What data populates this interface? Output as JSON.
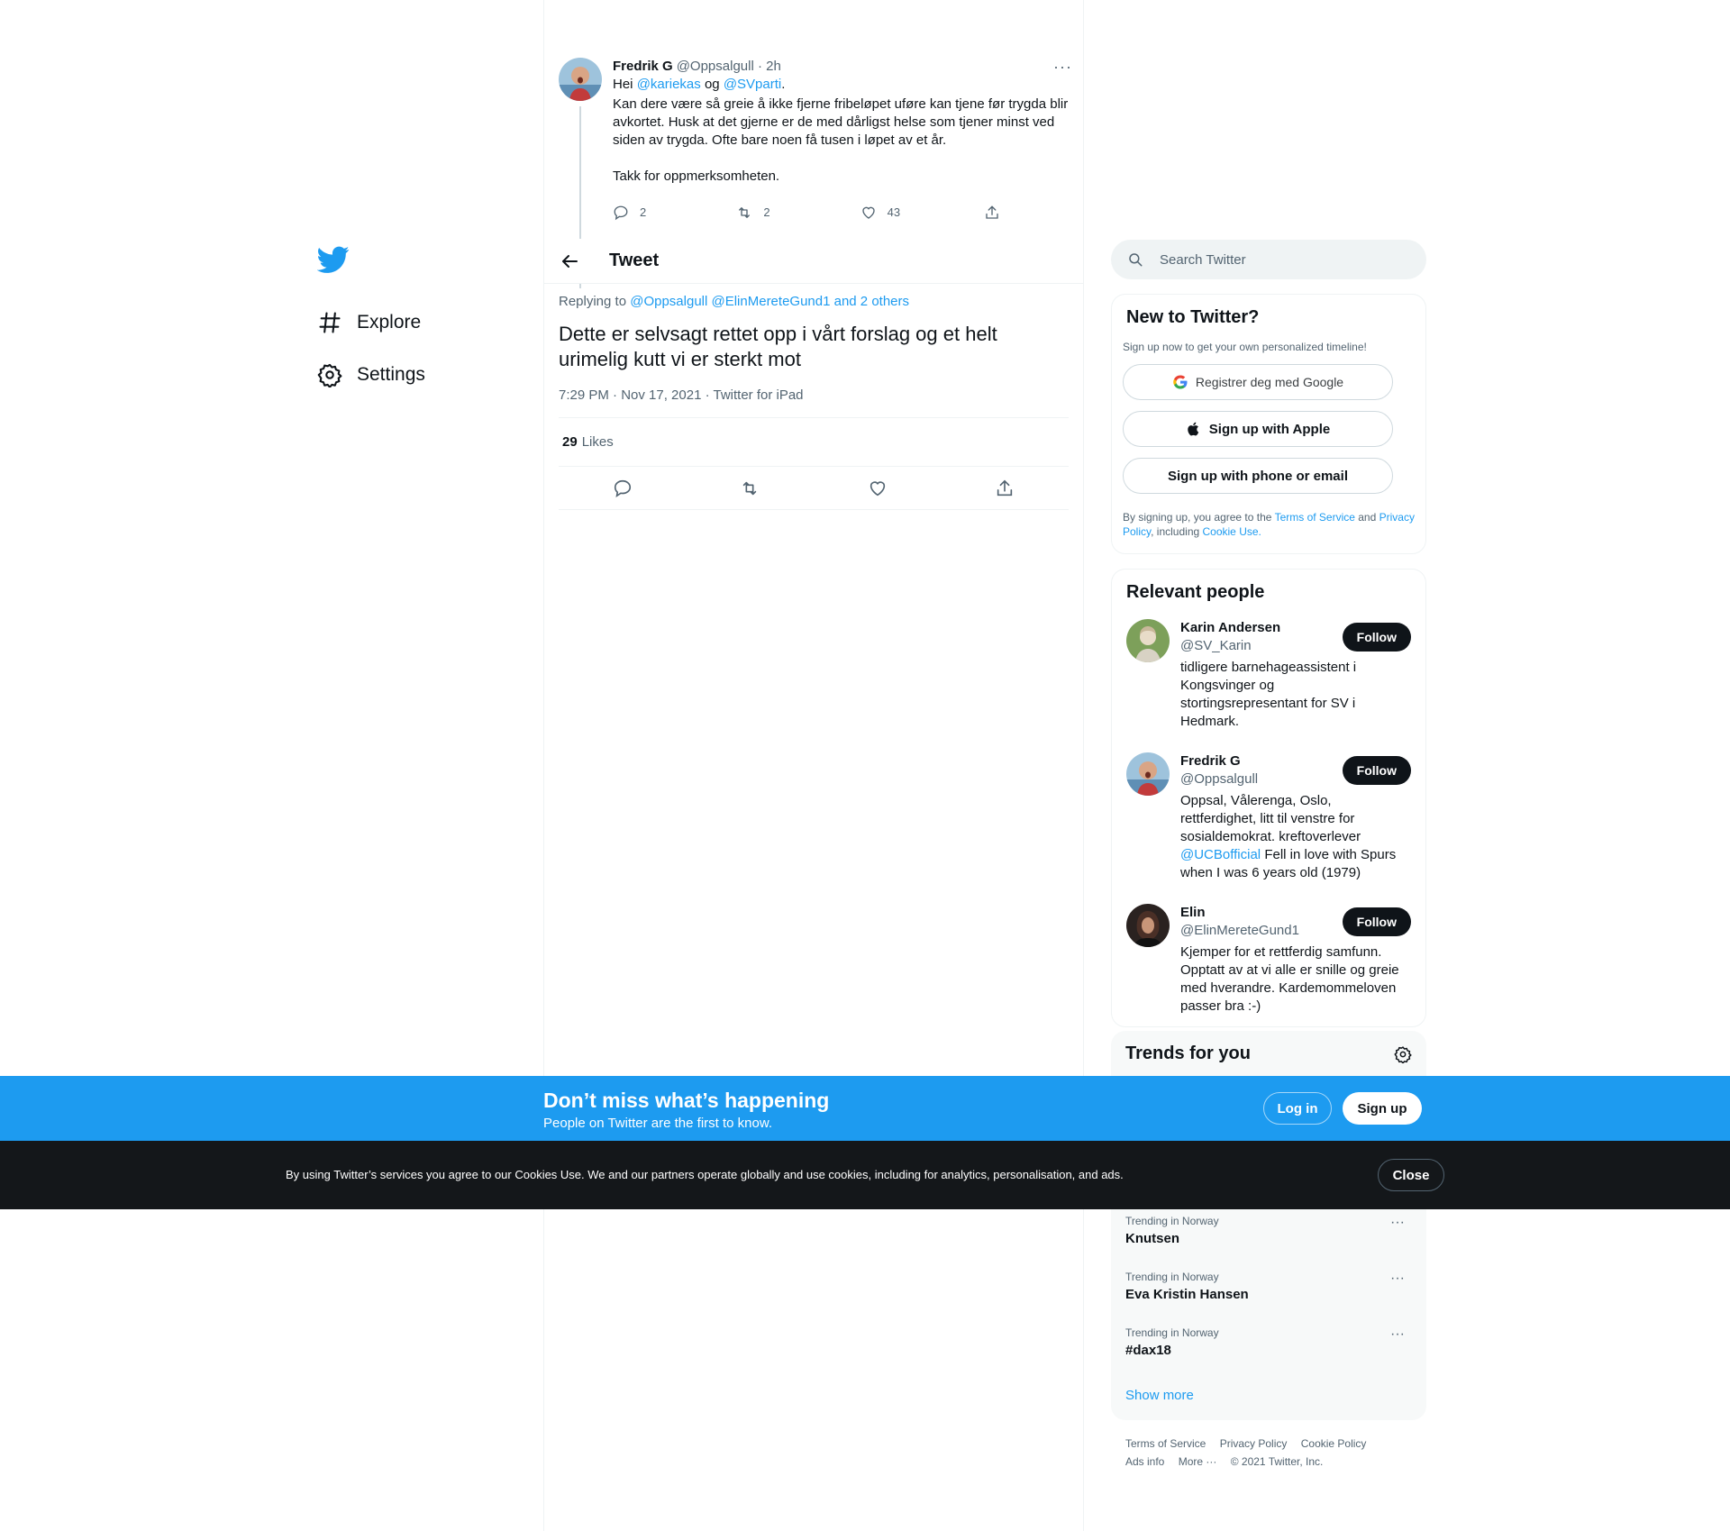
{
  "nav": {
    "items": [
      {
        "label": "Explore",
        "icon": "hashtag-icon"
      },
      {
        "label": "Settings",
        "icon": "gear-icon"
      }
    ]
  },
  "parent_tweet": {
    "name": "Fredrik G",
    "handle_time": "@Oppsalgull · 2h",
    "line1_hei": "Hei ",
    "mention1": "@kariekas",
    "line1_og": " og ",
    "mention2": "@SVparti",
    "line1_end": ".",
    "text": "Kan dere være så greie å ikke fjerne fribeløpet uføre kan tjene før trygda blir avkortet. Husk at det gjerne er de med dårligst helse som tjener minst ved siden av trygda. Ofte bare noen få tusen i løpet av et år.\n\nTakk for oppmerksomheten.",
    "replies": "2",
    "retweets": "2",
    "likes": "43",
    "more": "···"
  },
  "header": {
    "title": "Tweet"
  },
  "main_tweet": {
    "replying_prefix": "Replying to ",
    "replying_to": "@Oppsalgull @ElinMereteGund1 and 2 others",
    "text": "Dette er selvsagt rettet opp i vårt forslag og et helt urimelig kutt vi er sterkt mot",
    "meta": "7:29 PM · Nov 17, 2021 · Twitter for iPad",
    "likes_count": "29",
    "likes_label": "Likes"
  },
  "search": {
    "placeholder": "Search Twitter"
  },
  "new_to_twitter": {
    "title": "New to Twitter?",
    "subtitle": "Sign up now to get your own personalized timeline!",
    "google": "Registrer deg med Google",
    "apple": "Sign up with Apple",
    "phone": "Sign up with phone or email",
    "legal_prefix": "By signing up, you agree to the ",
    "terms": "Terms of Service",
    "and": " and ",
    "privacy": "Privacy Policy",
    "including": ", including ",
    "cookie": "Cookie Use."
  },
  "relevant": {
    "title": "Relevant people",
    "follow": "Follow",
    "people": [
      {
        "name": "Karin Andersen",
        "handle": "@SV_Karin",
        "bio": "tidligere barnehageassistent i Kongsvinger og stortingsrepresentant for SV i Hedmark."
      },
      {
        "name": "Fredrik G",
        "handle": "@Oppsalgull",
        "bio_a": "Oppsal, Vålerenga, Oslo, rettferdighet, litt til venstre for sosialdemokrat. kreftoverlever ",
        "bio_link": "@UCBofficial",
        "bio_b": " Fell in love with Spurs when I was 6 years old (1979)"
      },
      {
        "name": "Elin",
        "handle": "@ElinMereteGund1",
        "bio": "Kjemper for et rettferdig samfunn. Opptatt av at vi alle er snille og greie med hverandre. Kardemommeloven passer bra :-)"
      }
    ]
  },
  "trends": {
    "title": "Trends for you",
    "items": [
      {
        "category": "Trending in Norway",
        "name": "Knutsen"
      },
      {
        "category": "Trending in Norway",
        "name": "Eva Kristin Hansen"
      },
      {
        "category": "Trending in Norway",
        "name": "#dax18"
      }
    ],
    "more": "···",
    "show_more": "Show more"
  },
  "footer": {
    "links": [
      "Terms of Service",
      "Privacy Policy",
      "Cookie Policy"
    ],
    "ads": "Ads info",
    "more": "More ···",
    "copyright": "© 2021 Twitter, Inc."
  },
  "banner": {
    "title": "Don’t miss what’s happening",
    "subtitle": "People on Twitter are the first to know.",
    "login": "Log in",
    "signup": "Sign up"
  },
  "cookie": {
    "text": "By using Twitter’s services you agree to our Cookies Use. We and our partners operate globally and use cookies, including for analytics, personalisation, and ads.",
    "close": "Close"
  },
  "colors": {
    "accent": "#1d9bf0",
    "dark": "#0f1419",
    "muted": "#536471",
    "cookie_bg": "#14171a"
  }
}
